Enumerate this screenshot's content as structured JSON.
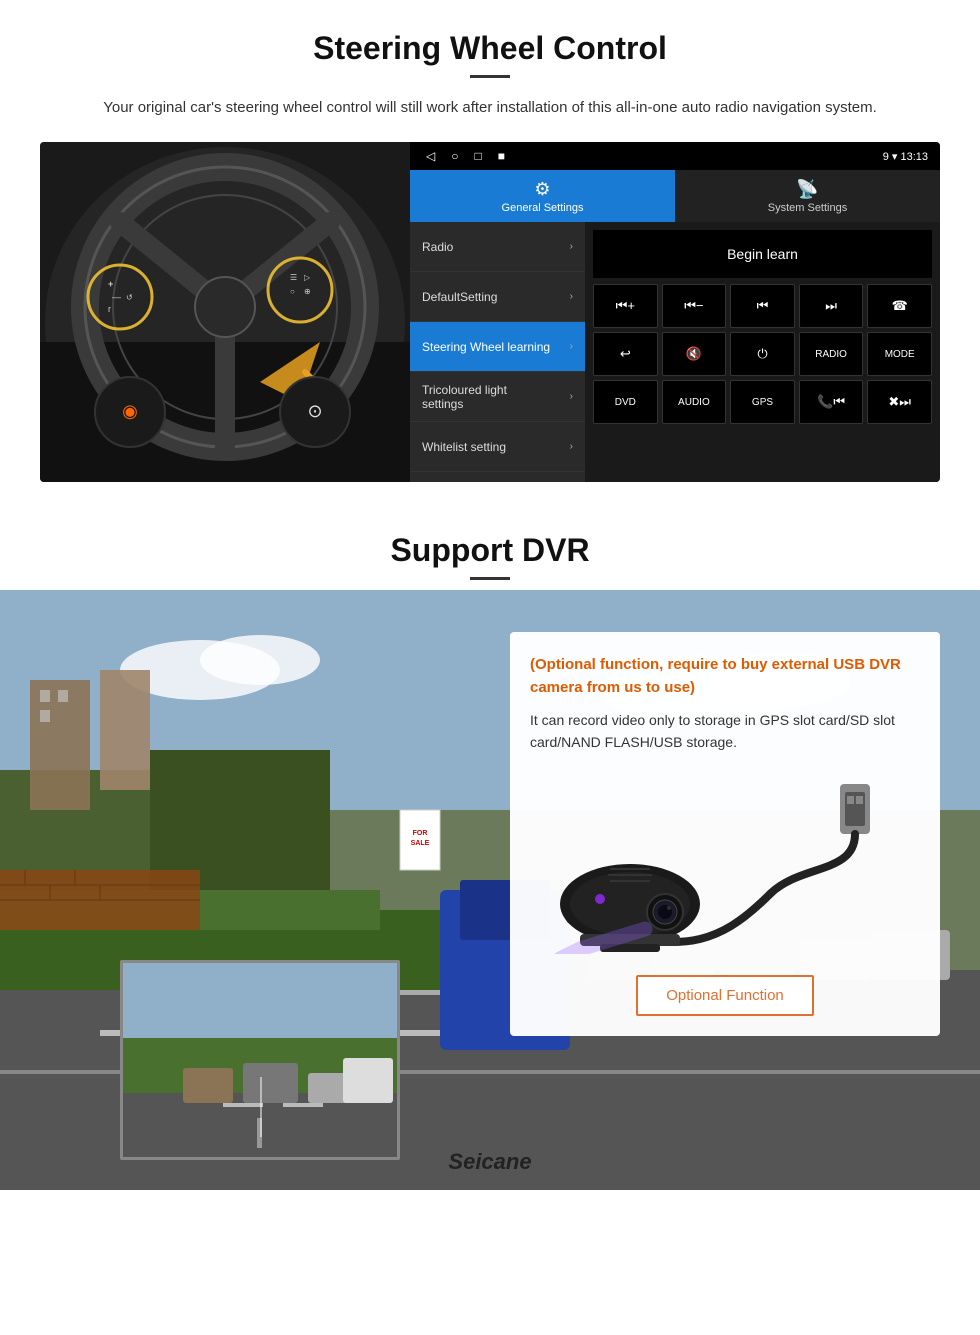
{
  "steering": {
    "title": "Steering Wheel Control",
    "subtitle": "Your original car's steering wheel control will still work after installation of this all-in-one auto radio navigation system.",
    "statusBar": {
      "navButtons": [
        "◁",
        "○",
        "□",
        "■"
      ],
      "rightInfo": "9 ▾ 13:13"
    },
    "tabs": {
      "general": {
        "icon": "⚙",
        "label": "General Settings"
      },
      "system": {
        "icon": "🎮",
        "label": "System Settings"
      }
    },
    "menuItems": [
      {
        "label": "Radio",
        "active": false
      },
      {
        "label": "DefaultSetting",
        "active": false
      },
      {
        "label": "Steering Wheel learning",
        "active": true
      },
      {
        "label": "Tricoloured light settings",
        "active": false
      },
      {
        "label": "Whitelist setting",
        "active": false
      }
    ],
    "beginLearnLabel": "Begin learn",
    "controlButtons": [
      "⏮+",
      "⏮-",
      "⏮",
      "⏭",
      "☎",
      "↩",
      "🔇",
      "⏻",
      "RADIO",
      "MODE",
      "DVD",
      "AUDIO",
      "GPS",
      "📞⏮",
      "✖⏭"
    ]
  },
  "dvr": {
    "title": "Support DVR",
    "optionalText": "(Optional function, require to buy external USB DVR camera from us to use)",
    "descText": "It can record video only to storage in GPS slot card/SD slot card/NAND FLASH/USB storage.",
    "optionalBtnLabel": "Optional Function",
    "brand": "Seicane"
  }
}
